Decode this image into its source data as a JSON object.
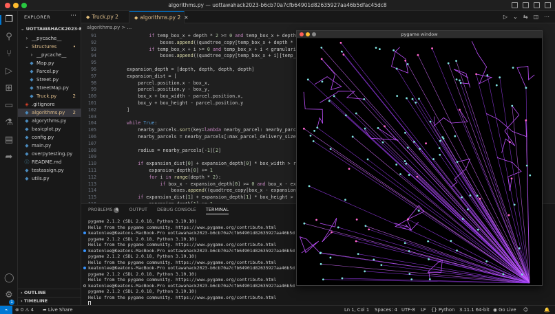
{
  "window": {
    "title": "algorithms.py — uottawahack2023-b6cb70a7cfb64901d82635927aa46b5dfac45dc8"
  },
  "sidebar": {
    "header": "EXPLORER",
    "root": "UOTTAWAHACK2023-B6...",
    "items": [
      {
        "label": "__pycache__",
        "kind": "folder",
        "indent": 1,
        "color": "#cccccc"
      },
      {
        "label": "Structures",
        "kind": "folder-open",
        "indent": 1,
        "color": "#e2c08d",
        "git": "•"
      },
      {
        "label": "__pycache__",
        "kind": "folder",
        "indent": 2,
        "color": "#cccccc"
      },
      {
        "label": "Map.py",
        "kind": "py",
        "indent": 2,
        "color": "#cccccc"
      },
      {
        "label": "Parcel.py",
        "kind": "py",
        "indent": 2,
        "color": "#cccccc"
      },
      {
        "label": "Street.py",
        "kind": "py",
        "indent": 2,
        "color": "#cccccc"
      },
      {
        "label": "StreetMap.py",
        "kind": "py",
        "indent": 2,
        "color": "#cccccc"
      },
      {
        "label": "Truck.py",
        "kind": "py",
        "indent": 2,
        "color": "#e2c08d",
        "git": "2"
      },
      {
        "label": ".gitignore",
        "kind": "git",
        "indent": 1,
        "color": "#cccccc"
      },
      {
        "label": "algorithms.py",
        "kind": "py",
        "indent": 1,
        "color": "#e2c08d",
        "git": "2",
        "selected": true
      },
      {
        "label": "algorythms.py",
        "kind": "py",
        "indent": 1,
        "color": "#cccccc"
      },
      {
        "label": "basicplot.py",
        "kind": "py",
        "indent": 1,
        "color": "#cccccc"
      },
      {
        "label": "config.py",
        "kind": "py",
        "indent": 1,
        "color": "#cccccc"
      },
      {
        "label": "main.py",
        "kind": "py",
        "indent": 1,
        "color": "#cccccc"
      },
      {
        "label": "overpytesting.py",
        "kind": "py",
        "indent": 1,
        "color": "#cccccc"
      },
      {
        "label": "README.md",
        "kind": "md",
        "indent": 1,
        "color": "#cccccc"
      },
      {
        "label": "testassign.py",
        "kind": "py",
        "indent": 1,
        "color": "#cccccc"
      },
      {
        "label": "utils.py",
        "kind": "py",
        "indent": 1,
        "color": "#cccccc"
      }
    ],
    "outline": "OUTLINE",
    "timeline": "TIMELINE"
  },
  "tabs": [
    {
      "label": "Truck.py",
      "mod": "2",
      "active": false
    },
    {
      "label": "algorithms.py",
      "mod": "2",
      "active": true,
      "close": "✕"
    }
  ],
  "breadcrumb": "algorithms.py > ...",
  "code": [
    {
      "n": "91",
      "t": "            if temp_box_x + depth * 2 >= 0 and temp_box_x + depth * 2 <"
    },
    {
      "n": "92",
      "t": "                boxes.append((quadtree_copy[temp_box_x + depth * 2][tem"
    },
    {
      "n": "93",
      "t": "            if temp_box_x + i >= 0 and temp_box_x + i < granularity and"
    },
    {
      "n": "94",
      "t": "                boxes.append((quadtree_copy[temp_box_x + i][temp_box_y"
    },
    {
      "n": "95",
      "t": ""
    },
    {
      "n": "96",
      "t": "    expansion_depth = [depth, depth, depth, depth]"
    },
    {
      "n": "97",
      "t": "    expansion_dist = ["
    },
    {
      "n": "98",
      "t": "        parcel.position.x - box_x,"
    },
    {
      "n": "99",
      "t": "        parcel.position.y - box_y,"
    },
    {
      "n": "100",
      "t": "        box_x + box_width - parcel.position.x,"
    },
    {
      "n": "101",
      "t": "        box_y + box_height - parcel.position.y"
    },
    {
      "n": "102",
      "t": "    ]"
    },
    {
      "n": "103",
      "t": ""
    },
    {
      "n": "104",
      "t": "    while True:"
    },
    {
      "n": "105",
      "t": "        nearby_parcels.sort(key=lambda nearby_parcel: nearby_parcel[2])"
    },
    {
      "n": "106",
      "t": "        nearby_parcels = nearby_parcels[:max_parcel_delivery_size]"
    },
    {
      "n": "107",
      "t": ""
    },
    {
      "n": "108",
      "t": "        radius = nearby_parcels[-1][2]"
    },
    {
      "n": "109",
      "t": ""
    },
    {
      "n": "110",
      "t": "        if expansion_dist[0] + expansion_depth[0] * box_width > radius:"
    },
    {
      "n": "111",
      "t": "            expansion_depth[0] += 1"
    },
    {
      "n": "112",
      "t": "            for i in range(depth * 2):"
    },
    {
      "n": "113",
      "t": "                if box_x - expansion_depth[0] >= 0 and box_x - expansi"
    },
    {
      "n": "114",
      "t": "                    boxes.append((quadtree_copy[box_x - expansion_dept"
    },
    {
      "n": "115",
      "t": "        if expansion_dist[1] + expansion_depth[1] * box_height > radiu"
    },
    {
      "n": "116",
      "t": "            expansion_depth[1] += 1"
    }
  ],
  "panel": {
    "tabs": [
      "PROBLEMS",
      "OUTPUT",
      "DEBUG CONSOLE",
      "TERMINAL"
    ],
    "problems_count": "4",
    "terminal": [
      {
        "dot": "",
        "t": "pygame 2.1.2 (SDL 2.0.18, Python 3.10.10)"
      },
      {
        "dot": "",
        "t": "Hello from the pygame community. https://www.pygame.org/contribute.html"
      },
      {
        "dot": "blue",
        "t": "keatonlee@Keatons-MacBook-Pro uottawahack2023-b6cb70a7cfb64901d82635927aa46b5d"
      },
      {
        "dot": "",
        "t": "pygame 2.1.2 (SDL 2.0.18, Python 3.10.10)"
      },
      {
        "dot": "",
        "t": "Hello from the pygame community. https://www.pygame.org/contribute.html"
      },
      {
        "dot": "blue",
        "t": "keatonlee@Keatons-MacBook-Pro uottawahack2023-b6cb70a7cfb64901d82635927aa46b5d"
      },
      {
        "dot": "",
        "t": "pygame 2.1.2 (SDL 2.0.18, Python 3.10.10)"
      },
      {
        "dot": "",
        "t": "Hello from the pygame community. https://www.pygame.org/contribute.html"
      },
      {
        "dot": "blue",
        "t": "keatonlee@Keatons-MacBook-Pro uottawahack2023-b6cb70a7cfb64901d82635927aa46b5d"
      },
      {
        "dot": "",
        "t": "pygame 2.1.2 (SDL 2.0.18, Python 3.10.10)"
      },
      {
        "dot": "",
        "t": "Hello from the pygame community. https://www.pygame.org/contribute.html"
      },
      {
        "dot": "ring",
        "t": "keatonlee@Keatons-MacBook-Pro uottawahack2023-b6cb70a7cfb64901d82635927aa46b5d"
      },
      {
        "dot": "",
        "t": "pygame 2.1.2 (SDL 2.0.18, Python 3.10.10)"
      },
      {
        "dot": "",
        "t": "Hello from the pygame community. https://www.pygame.org/contribute.html"
      }
    ]
  },
  "statusbar": {
    "errors": "0",
    "warnings": "4",
    "live_share": "Live Share",
    "position": "Ln 1, Col 1",
    "spaces": "Spaces: 4",
    "encoding": "UTF-8",
    "eol": "LF",
    "language": "Python",
    "interpreter": "3.11.1 64-bit",
    "go_live": "Go Live"
  },
  "pygame": {
    "title": "pygame window"
  },
  "colors": {
    "accent": "#0078d4",
    "modified": "#e2c08d",
    "route": "#b44cff",
    "node": "#7fe3e0",
    "nodeAlt": "#ff66cc"
  }
}
